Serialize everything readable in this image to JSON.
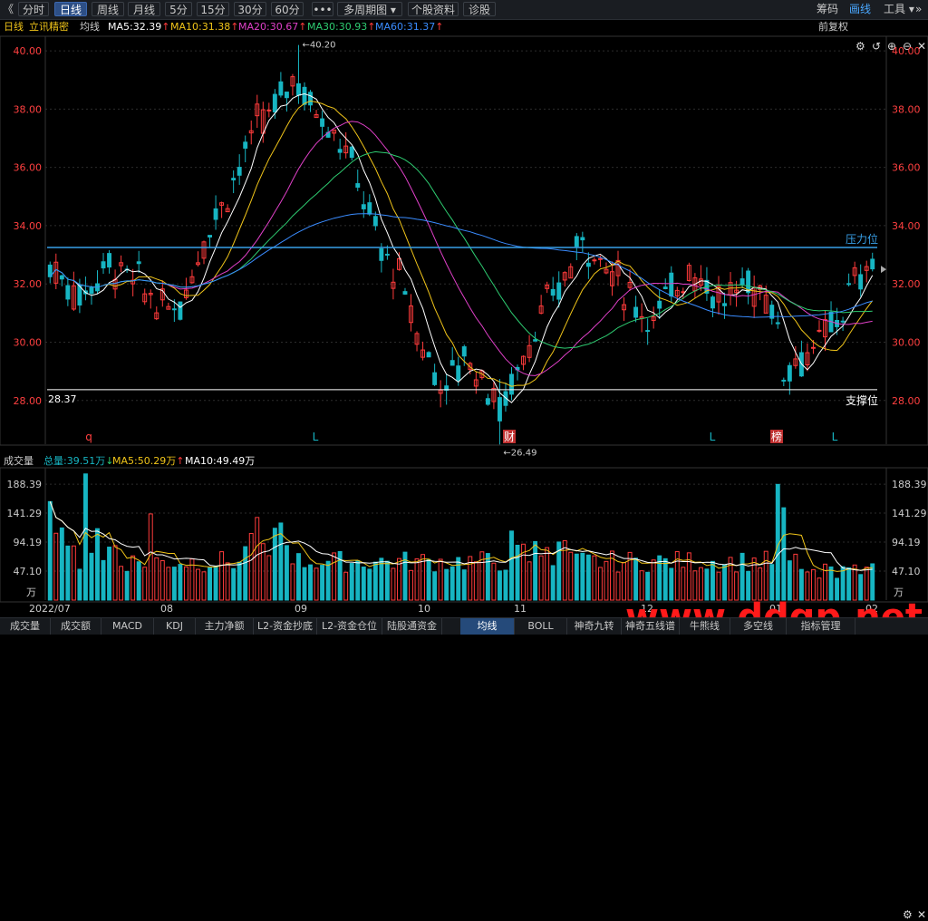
{
  "toolbar": {
    "back_icon": "《",
    "periods": [
      "分时",
      "日线",
      "周线",
      "月线",
      "5分",
      "15分",
      "30分",
      "60分"
    ],
    "active_period": "日线",
    "more_icon": "•••",
    "multi_period": "多周期图",
    "stock_info": "个股资料",
    "diagnose": "诊股",
    "chips": "筹码",
    "draw": "画线",
    "tools": "工具"
  },
  "legend": {
    "period": "日线",
    "stock_name": "立讯精密",
    "avg_label": "均线",
    "ma5": "MA5:32.39",
    "ma10": "MA10:31.38",
    "ma20": "MA20:30.67",
    "ma30": "MA30:30.93",
    "ma60": "MA60:31.37",
    "adjust": "前复权",
    "up_arrow": "↑"
  },
  "volume_legend": {
    "title": "成交量",
    "total": "总量:39.51万",
    "ma5": "MA5:50.29万",
    "ma10": "MA10:49.49万",
    "down_arrow": "↓",
    "up_arrow": "↑"
  },
  "tabs": [
    "成交量",
    "成交额",
    "MACD",
    "KDJ",
    "主力净额",
    "L2-资金抄底",
    "L2-资金仓位",
    "陆股通资金",
    "均线",
    "BOLL",
    "神奇九转",
    "神奇五线谱",
    "牛熊线",
    "多空线",
    "指标管理"
  ],
  "active_tab": "均线",
  "colors": {
    "up": "#ff3b3b",
    "down": "#17b5c2",
    "ma5": "#ffffff",
    "ma10": "#f0c419",
    "ma20": "#e040c8",
    "ma30": "#2ecc71",
    "ma60": "#3a8cff",
    "resistance": "#38a0e8",
    "support": "#ffffff",
    "axis_label": "#ff4040"
  },
  "chart_data": [
    {
      "type": "candlestick",
      "ylim": [
        26.5,
        40.5
      ],
      "yticks": [
        28.0,
        30.0,
        32.0,
        34.0,
        36.0,
        38.0,
        40.0
      ],
      "ytick_labels": [
        "28.00",
        "30.00",
        "32.00",
        "34.00",
        "36.00",
        "38.00",
        "40.00"
      ],
      "high_annotation": {
        "label": "40.20",
        "value": 40.2
      },
      "low_annotation": {
        "label": "26.49",
        "value": 26.49
      },
      "resistance": {
        "label": "压力位",
        "value": 33.25
      },
      "support": {
        "label": "支撑位",
        "value": 28.37,
        "left_label": "28.37"
      },
      "event_markers": [
        "q",
        "L",
        "财",
        "L",
        "榜",
        "L"
      ],
      "ma_series": [
        {
          "name": "MA5",
          "color": "#ffffff"
        },
        {
          "name": "MA10",
          "color": "#f0c419"
        },
        {
          "name": "MA20",
          "color": "#e040c8"
        },
        {
          "name": "MA30",
          "color": "#2ecc71"
        },
        {
          "name": "MA60",
          "color": "#3a8cff"
        }
      ]
    },
    {
      "type": "bar",
      "ylim": [
        0,
        215
      ],
      "yticks": [
        47.1,
        94.19,
        141.29,
        188.39
      ],
      "ytick_labels": [
        "47.10",
        "94.19",
        "141.29",
        "188.39"
      ],
      "unit": "万",
      "x_labels": [
        "2022/07",
        "08",
        "09",
        "10",
        "11",
        "12",
        "01",
        "02"
      ]
    }
  ],
  "watermark": "www.ddgp.net"
}
